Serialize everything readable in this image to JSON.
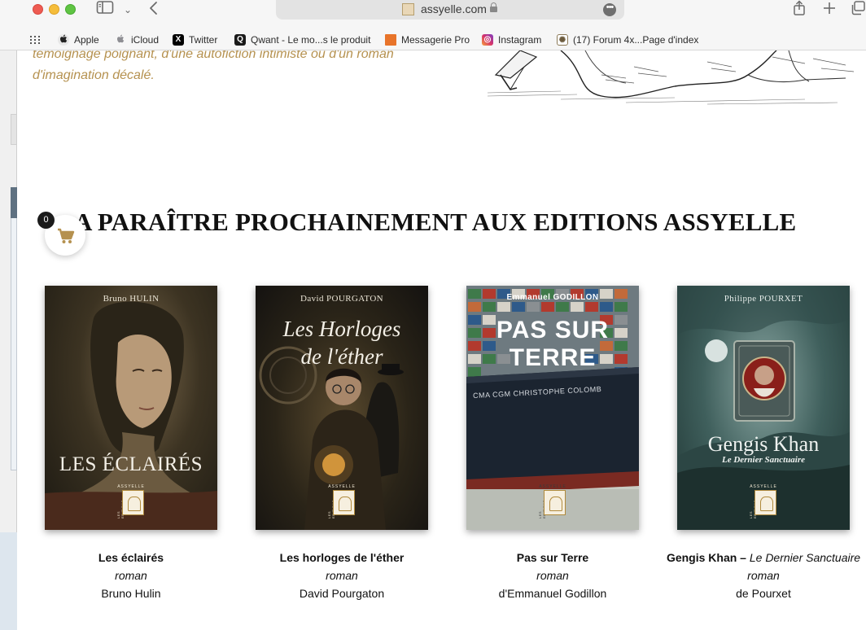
{
  "browser": {
    "url": "assyelle.com",
    "more_glyph": "•••",
    "sidebar_glyph": "▭",
    "chevron_down_glyph": "⌄",
    "back_glyph": "‹",
    "share_glyph": "⇪",
    "new_tab_glyph": "+",
    "tabs_glyph": "⧉"
  },
  "bookmarks": [
    {
      "label": "Apple",
      "icon": "apple-icon",
      "glyph": "",
      "color": "#1d1d1f"
    },
    {
      "label": "iCloud",
      "icon": "apple-icon",
      "glyph": "",
      "color": "#8e8e93"
    },
    {
      "label": "Twitter",
      "icon": "x-icon",
      "glyph": "X",
      "color": "#000000"
    },
    {
      "label": "Qwant - Le mo...s le produit",
      "icon": "qwant-icon",
      "glyph": "Q",
      "color": "#1a1a1a"
    },
    {
      "label": "Messagerie Pro",
      "icon": "mail-icon",
      "glyph": "",
      "color": "#e8742a"
    },
    {
      "label": "Instagram",
      "icon": "instagram-icon",
      "glyph": "◎",
      "color": "#d6336c"
    },
    {
      "label": "(17) Forum 4x...Page d'index",
      "icon": "forum-icon",
      "glyph": "✺",
      "color": "#6b5a3c"
    }
  ],
  "intro": {
    "line1": "témoignage poignant, d'une autofiction intimiste ou d'un roman",
    "line2": "d'imagination décalé."
  },
  "section_title": "A PARAÎTRE PROCHAINEMENT AUX EDITIONS ASSYELLE",
  "cart": {
    "count": "0",
    "icon": "cart-icon"
  },
  "publisher_logo": {
    "label": "ASSYELLE",
    "side": "LES EDITIONS"
  },
  "books": [
    {
      "cover_author": "Bruno HULIN",
      "cover_title": "LES ÉCLAIRÉS",
      "title": "Les éclairés",
      "genre": "roman",
      "author": "Bruno Hulin"
    },
    {
      "cover_author": "David POURGATON",
      "cover_title_line1": "Les Horloges",
      "cover_title_line2": "de l'éther",
      "title": "Les horloges de l'éther",
      "genre": "roman",
      "author": "David Pourgaton"
    },
    {
      "cover_author": "Emmanuel GODILLON",
      "cover_title_line1": "PAS SUR",
      "cover_title_line2": "TERRE",
      "ship_name": "CMA CGM CHRISTOPHE COLOMB",
      "title": "Pas sur Terre",
      "genre": "roman",
      "author": "d'Emmanuel Godillon"
    },
    {
      "cover_author": "Philippe POURXET",
      "cover_title": "Gengis Khan",
      "cover_subtitle": "Le Dernier Sanctuaire",
      "title": "Gengis Khan –",
      "subtitle": "Le Dernier Sanctuaire",
      "genre": "roman",
      "author": "de Pourxet"
    }
  ]
}
